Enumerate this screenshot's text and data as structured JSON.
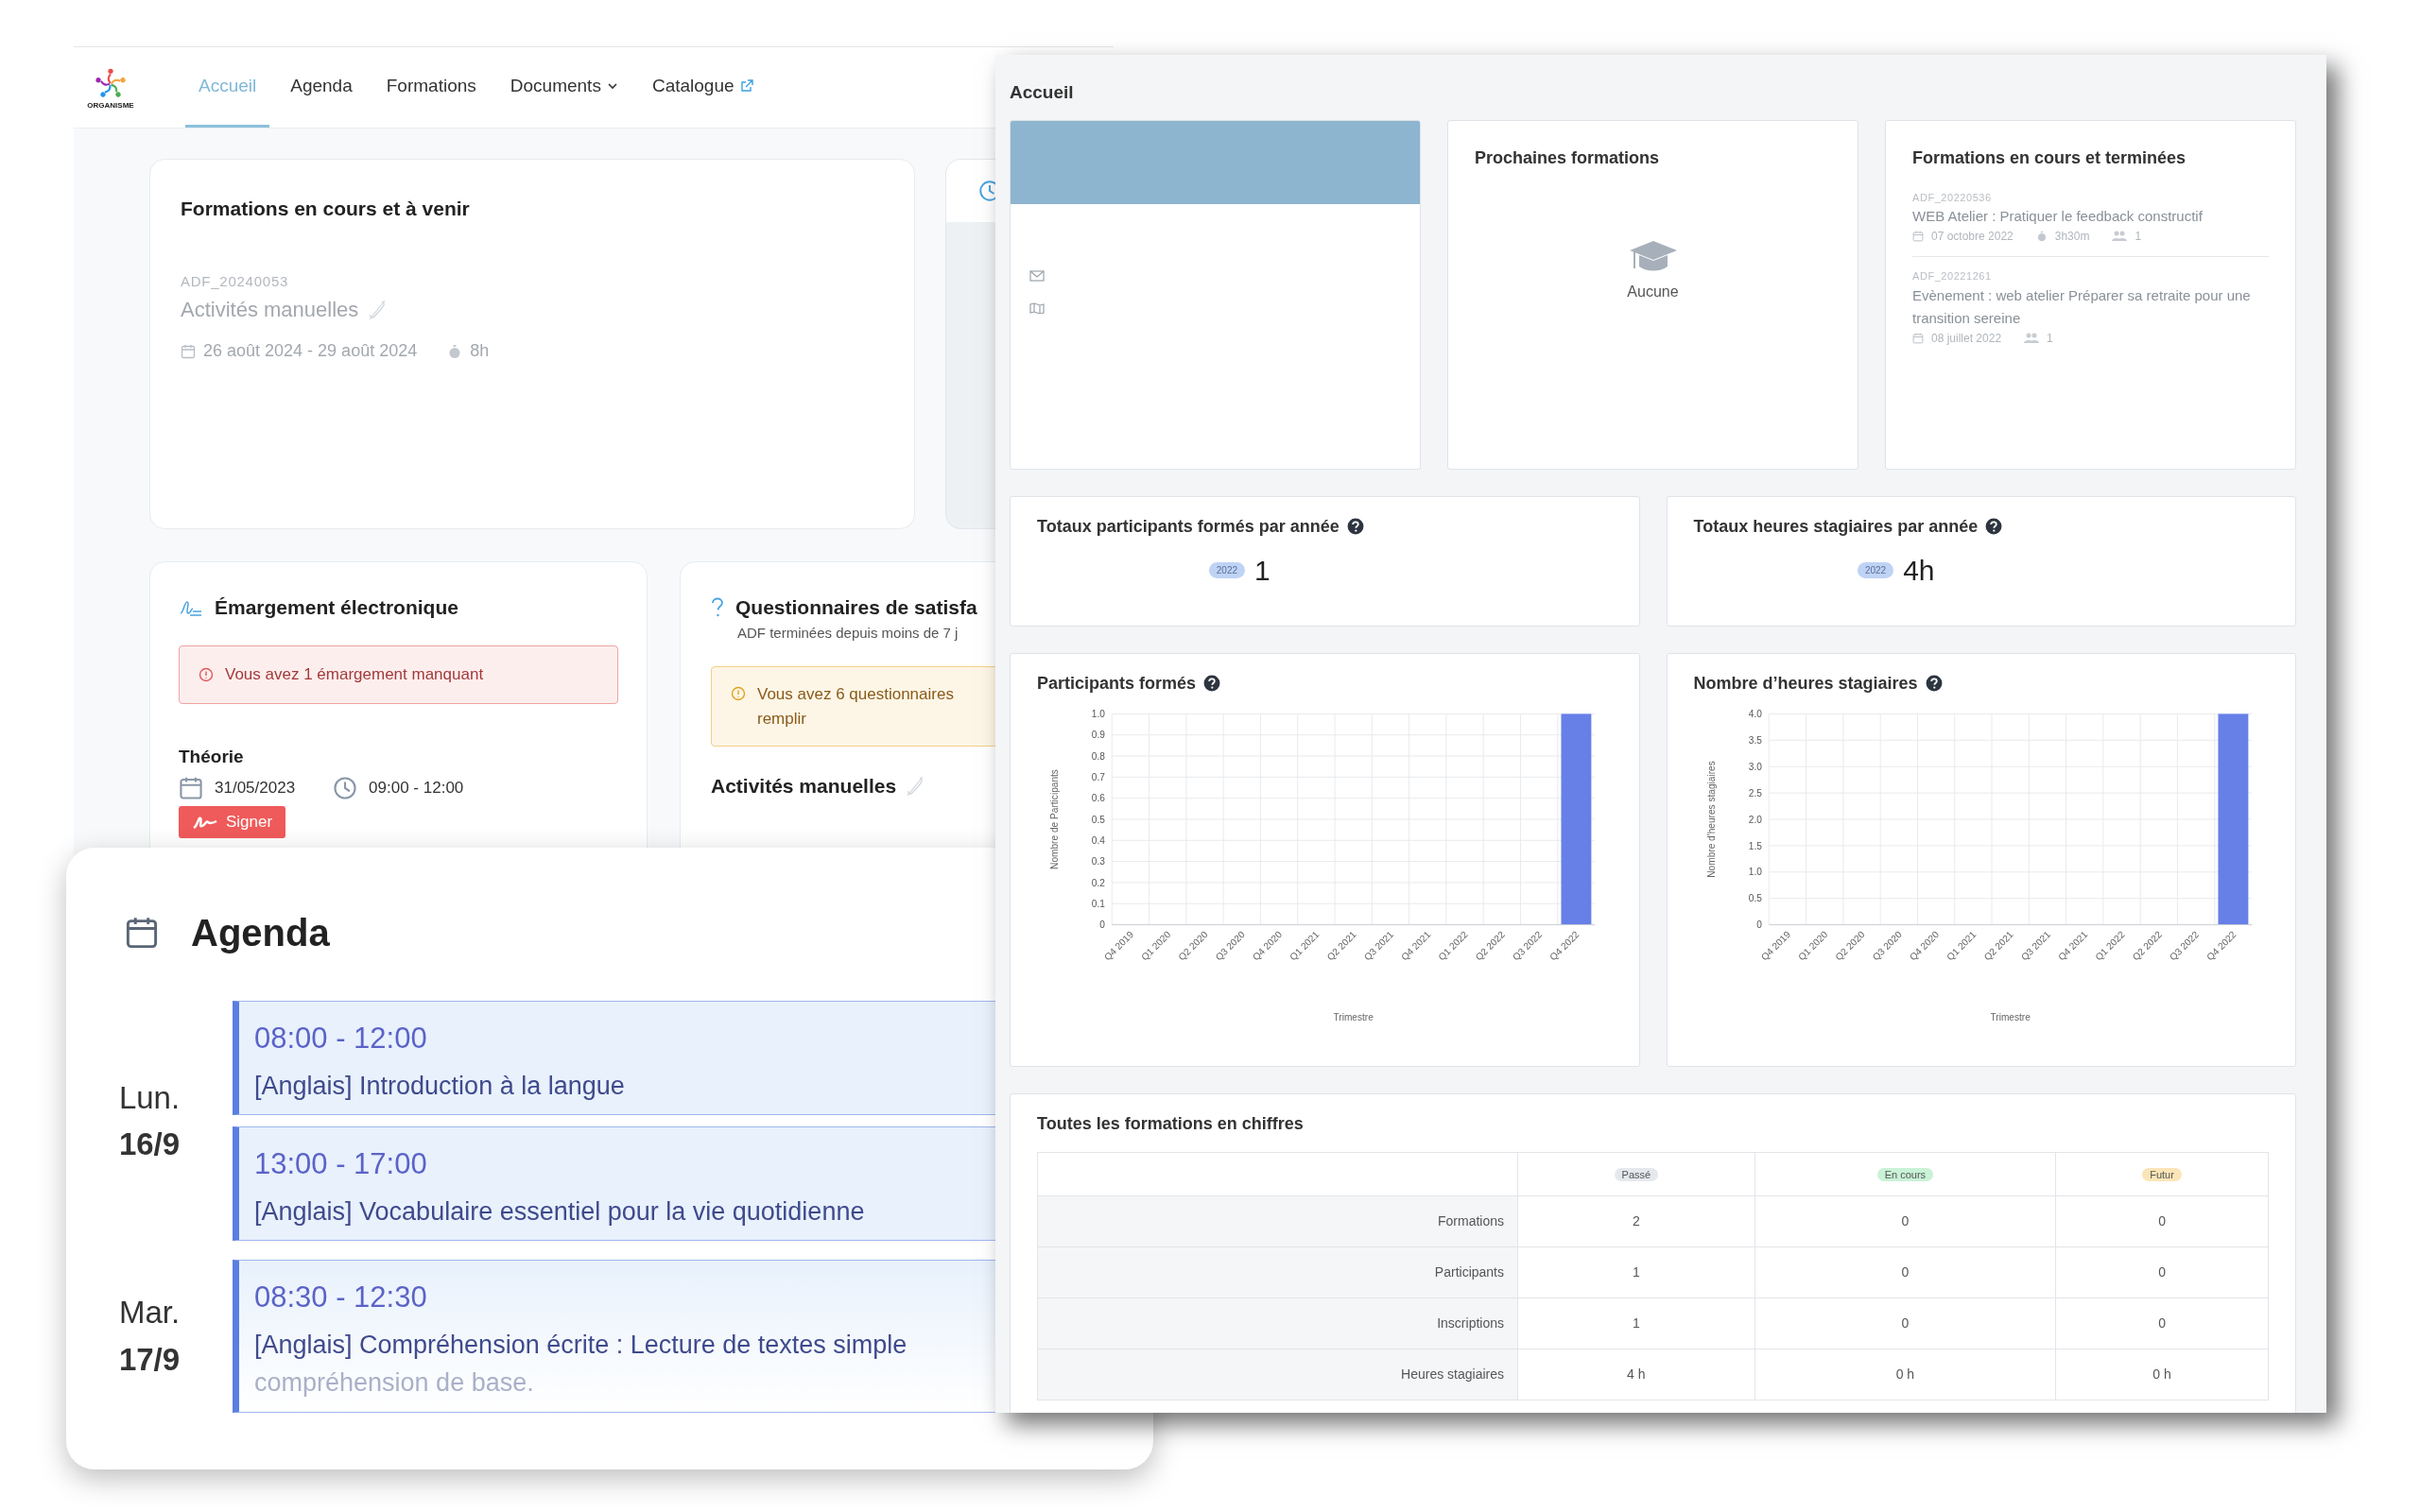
{
  "left_app": {
    "logo_text": "ORGANISME",
    "tabs": [
      {
        "label": "Accueil",
        "selected": true,
        "kind": "plain"
      },
      {
        "label": "Agenda",
        "selected": false,
        "kind": "plain"
      },
      {
        "label": "Formations",
        "selected": false,
        "kind": "plain"
      },
      {
        "label": "Documents",
        "selected": false,
        "kind": "dropdown"
      },
      {
        "label": "Catalogue",
        "selected": false,
        "kind": "external"
      }
    ],
    "current_card": {
      "title": "Formations en cours et à venir",
      "code": "ADF_20240053",
      "name": "Activités manuelles",
      "dates": "26 août 2024 - 29 août 2024",
      "duration": "8h"
    },
    "emargement": {
      "title": "Émargement électronique",
      "alert": "Vous avez 1 émargement manquant",
      "session": "Théorie",
      "date": "31/05/2023",
      "time": "09:00 - 12:00",
      "button": "Signer"
    },
    "questionnaires": {
      "title": "Questionnaires de satisfa",
      "subtitle": "ADF terminées depuis moins de 7 j",
      "alert_lines": [
        "Vous avez 6 questionnaires",
        "remplir"
      ],
      "training": "Activités manuelles"
    }
  },
  "agenda": {
    "title": "Agenda",
    "days": [
      {
        "weekday": "Lun.",
        "date": "16/9",
        "events": [
          {
            "time": "08:00 - 12:00",
            "title": "[Anglais] Introduction à la langue"
          },
          {
            "time": "13:00 - 17:00",
            "title": "[Anglais] Vocabulaire essentiel pour la vie quotidienne"
          }
        ]
      },
      {
        "weekday": "Mar.",
        "date": "17/9",
        "events": [
          {
            "time": "08:30 - 12:30",
            "title": "[Anglais] Compréhension écrite : Lecture de textes simple",
            "more": "compréhension de base."
          }
        ]
      }
    ]
  },
  "dashboard": {
    "title": "Accueil",
    "upcoming": {
      "title": "Prochaines formations",
      "empty": "Aucune"
    },
    "past": {
      "title": "Formations en cours et terminées",
      "items": [
        {
          "code": "ADF_20220536",
          "name": "WEB Atelier : Pratiquer le feedback constructif",
          "date": "07 octobre 2022",
          "duration": "3h30m",
          "participants": "1"
        },
        {
          "code": "ADF_20221261",
          "name": "Evènement : web atelier Préparer sa retraite pour une transition sereine",
          "date": "08 juillet 2022",
          "participants": "1"
        }
      ]
    },
    "totals": [
      {
        "title": "Totaux participants formés par année",
        "year": "2022",
        "value": "1"
      },
      {
        "title": "Totaux heures stagiaires par année",
        "year": "2022",
        "value": "4h"
      }
    ],
    "charts": [
      {
        "title": "Participants formés",
        "chart_data": {
          "type": "bar",
          "xlabel": "Trimestre",
          "ylabel": "Nombre de Participants",
          "categories": [
            "Q4 2019",
            "Q1 2020",
            "Q2 2020",
            "Q3 2020",
            "Q4 2020",
            "Q1 2021",
            "Q2 2021",
            "Q3 2021",
            "Q4 2021",
            "Q1 2022",
            "Q2 2022",
            "Q3 2022",
            "Q4 2022"
          ],
          "grid": true,
          "series": [
            {
              "color": "#6680e8",
              "values": [
                0,
                0,
                0,
                0,
                0,
                0,
                0,
                0,
                0,
                0,
                0,
                0,
                1
              ]
            }
          ],
          "ylim": [
            0,
            1
          ],
          "yticks": [
            {
              "value": 0,
              "label": "0"
            },
            {
              "value": 0.1,
              "label": "0.1"
            },
            {
              "value": 0.2,
              "label": "0.2"
            },
            {
              "value": 0.3,
              "label": "0.3"
            },
            {
              "value": 0.4,
              "label": "0.4"
            },
            {
              "value": 0.5,
              "label": "0.5"
            },
            {
              "value": 0.6,
              "label": "0.6"
            },
            {
              "value": 0.7,
              "label": "0.7"
            },
            {
              "value": 0.8,
              "label": "0.8"
            },
            {
              "value": 0.9,
              "label": "0.9"
            },
            {
              "value": 1,
              "label": "1.0"
            }
          ]
        }
      },
      {
        "title": "Nombre d’heures stagiaires",
        "chart_data": {
          "type": "bar",
          "xlabel": "Trimestre",
          "ylabel": "Nombre d'heures stagiaires",
          "categories": [
            "Q4 2019",
            "Q1 2020",
            "Q2 2020",
            "Q3 2020",
            "Q4 2020",
            "Q1 2021",
            "Q2 2021",
            "Q3 2021",
            "Q4 2021",
            "Q1 2022",
            "Q2 2022",
            "Q3 2022",
            "Q4 2022"
          ],
          "grid": true,
          "series": [
            {
              "color": "#6680e8",
              "values": [
                0,
                0,
                0,
                0,
                0,
                0,
                0,
                0,
                0,
                0,
                0,
                0,
                4
              ]
            }
          ],
          "ylim": [
            0,
            4
          ],
          "yticks": [
            {
              "value": 0,
              "label": "0"
            },
            {
              "value": 0.5,
              "label": "0.5"
            },
            {
              "value": 1,
              "label": "1.0"
            },
            {
              "value": 1.5,
              "label": "1.5"
            },
            {
              "value": 2,
              "label": "2.0"
            },
            {
              "value": 2.5,
              "label": "2.5"
            },
            {
              "value": 3,
              "label": "3.0"
            },
            {
              "value": 3.5,
              "label": "3.5"
            },
            {
              "value": 4,
              "label": "4.0"
            }
          ]
        }
      }
    ],
    "table": {
      "title": "Toutes les formations en chiffres",
      "columns": [
        {
          "label": "Passé",
          "color": "#e5e9ee"
        },
        {
          "label": "En cours",
          "color": "#c9f2d6"
        },
        {
          "label": "Futur",
          "color": "#fbe5b8"
        }
      ],
      "rows": [
        {
          "label": "Formations",
          "cells": [
            "2",
            "0",
            "0"
          ]
        },
        {
          "label": "Participants",
          "cells": [
            "1",
            "0",
            "0"
          ]
        },
        {
          "label": "Inscriptions",
          "cells": [
            "1",
            "0",
            "0"
          ]
        },
        {
          "label": "Heures stagiaires",
          "cells": [
            "4 h",
            "0 h",
            "0 h"
          ]
        }
      ]
    }
  }
}
